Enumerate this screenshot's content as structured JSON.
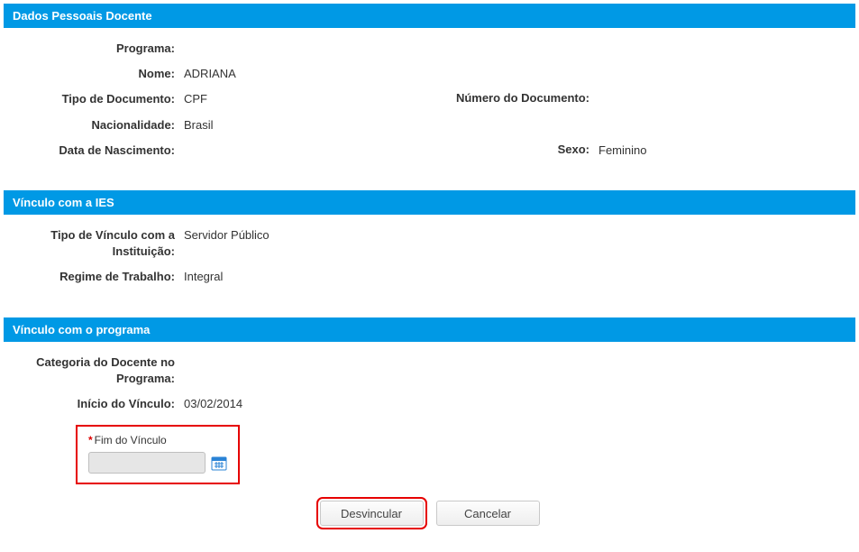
{
  "sections": {
    "dados_pessoais": {
      "title": "Dados Pessoais Docente",
      "programa_label": "Programa:",
      "programa_value": "",
      "nome_label": "Nome:",
      "nome_value": "ADRIANA",
      "tipo_documento_label": "Tipo de Documento:",
      "tipo_documento_value": "CPF",
      "numero_documento_label": "Número do Documento:",
      "numero_documento_value": "",
      "nacionalidade_label": "Nacionalidade:",
      "nacionalidade_value": "Brasil",
      "data_nascimento_label": "Data de Nascimento:",
      "data_nascimento_value": "",
      "sexo_label": "Sexo:",
      "sexo_value": "Feminino"
    },
    "vinculo_ies": {
      "title": "Vínculo com a IES",
      "tipo_vinculo_label": "Tipo de Vínculo com a Instituição:",
      "tipo_vinculo_value": "Servidor Público",
      "regime_label": "Regime de Trabalho:",
      "regime_value": "Integral"
    },
    "vinculo_programa": {
      "title": "Vínculo com o programa",
      "categoria_label": "Categoria do Docente no Programa:",
      "categoria_value": "",
      "inicio_label": "Início do Vínculo:",
      "inicio_value": "03/02/2014",
      "fim_label": "Fim do Vínculo",
      "fim_value": ""
    }
  },
  "buttons": {
    "desvincular": "Desvincular",
    "cancelar": "Cancelar"
  }
}
